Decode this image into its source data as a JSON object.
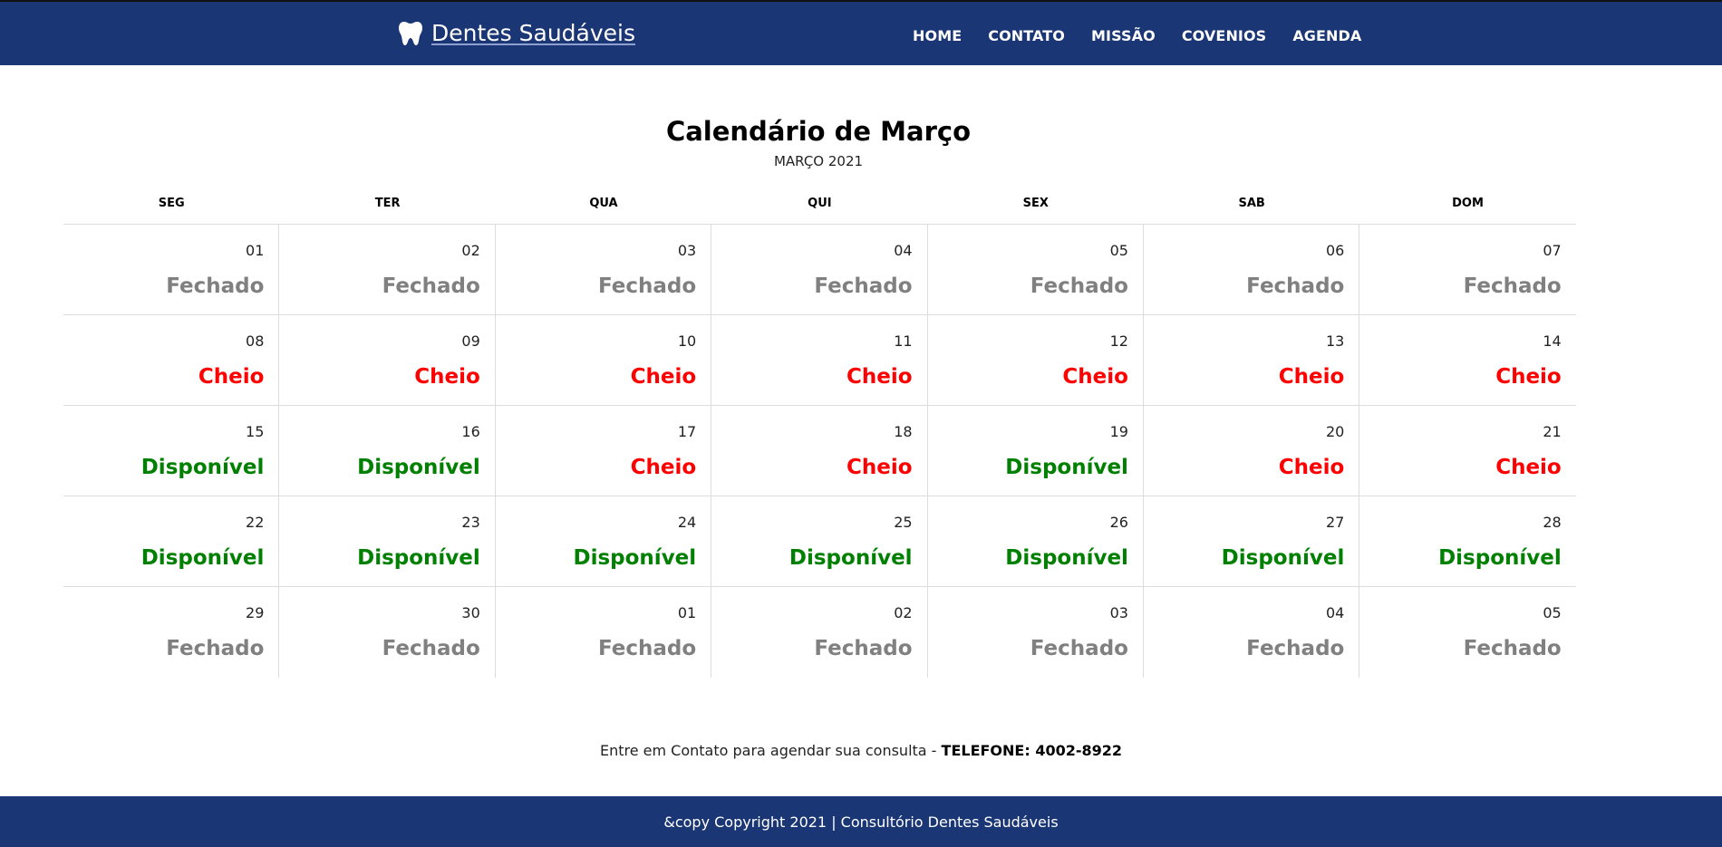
{
  "header": {
    "brand": "Dentes Saudáveis",
    "brand_icon": "tooth-icon",
    "nav": [
      "HOME",
      "CONTATO",
      "MISSÃO",
      "COVENIOS",
      "AGENDA"
    ]
  },
  "calendar": {
    "title": "Calendário de Março",
    "subtitle": "MARÇO 2021",
    "weekdays": [
      "SEG",
      "TER",
      "QUA",
      "QUI",
      "SEX",
      "SAB",
      "DOM"
    ],
    "weeks": [
      [
        {
          "day": "01",
          "status": "Fechado"
        },
        {
          "day": "02",
          "status": "Fechado"
        },
        {
          "day": "03",
          "status": "Fechado"
        },
        {
          "day": "04",
          "status": "Fechado"
        },
        {
          "day": "05",
          "status": "Fechado"
        },
        {
          "day": "06",
          "status": "Fechado"
        },
        {
          "day": "07",
          "status": "Fechado"
        }
      ],
      [
        {
          "day": "08",
          "status": "Cheio"
        },
        {
          "day": "09",
          "status": "Cheio"
        },
        {
          "day": "10",
          "status": "Cheio"
        },
        {
          "day": "11",
          "status": "Cheio"
        },
        {
          "day": "12",
          "status": "Cheio"
        },
        {
          "day": "13",
          "status": "Cheio"
        },
        {
          "day": "14",
          "status": "Cheio"
        }
      ],
      [
        {
          "day": "15",
          "status": "Disponível"
        },
        {
          "day": "16",
          "status": "Disponível"
        },
        {
          "day": "17",
          "status": "Cheio"
        },
        {
          "day": "18",
          "status": "Cheio"
        },
        {
          "day": "19",
          "status": "Disponível"
        },
        {
          "day": "20",
          "status": "Cheio"
        },
        {
          "day": "21",
          "status": "Cheio"
        }
      ],
      [
        {
          "day": "22",
          "status": "Disponível"
        },
        {
          "day": "23",
          "status": "Disponível"
        },
        {
          "day": "24",
          "status": "Disponível"
        },
        {
          "day": "25",
          "status": "Disponível"
        },
        {
          "day": "26",
          "status": "Disponível"
        },
        {
          "day": "27",
          "status": "Disponível"
        },
        {
          "day": "28",
          "status": "Disponível"
        }
      ],
      [
        {
          "day": "29",
          "status": "Fechado"
        },
        {
          "day": "30",
          "status": "Fechado"
        },
        {
          "day": "01",
          "status": "Fechado"
        },
        {
          "day": "02",
          "status": "Fechado"
        },
        {
          "day": "03",
          "status": "Fechado"
        },
        {
          "day": "04",
          "status": "Fechado"
        },
        {
          "day": "05",
          "status": "Fechado"
        }
      ]
    ]
  },
  "contact": {
    "text": "Entre em Contato para agendar sua consulta - ",
    "phone": "TELEFONE: 4002-8922"
  },
  "footer": {
    "text": "&copy Copyright 2021 | Consultório Dentes Saudáveis"
  },
  "colors": {
    "navbar": "#1b3674",
    "fechado": "#808080",
    "cheio": "#ff0000",
    "disponivel": "#008000"
  }
}
